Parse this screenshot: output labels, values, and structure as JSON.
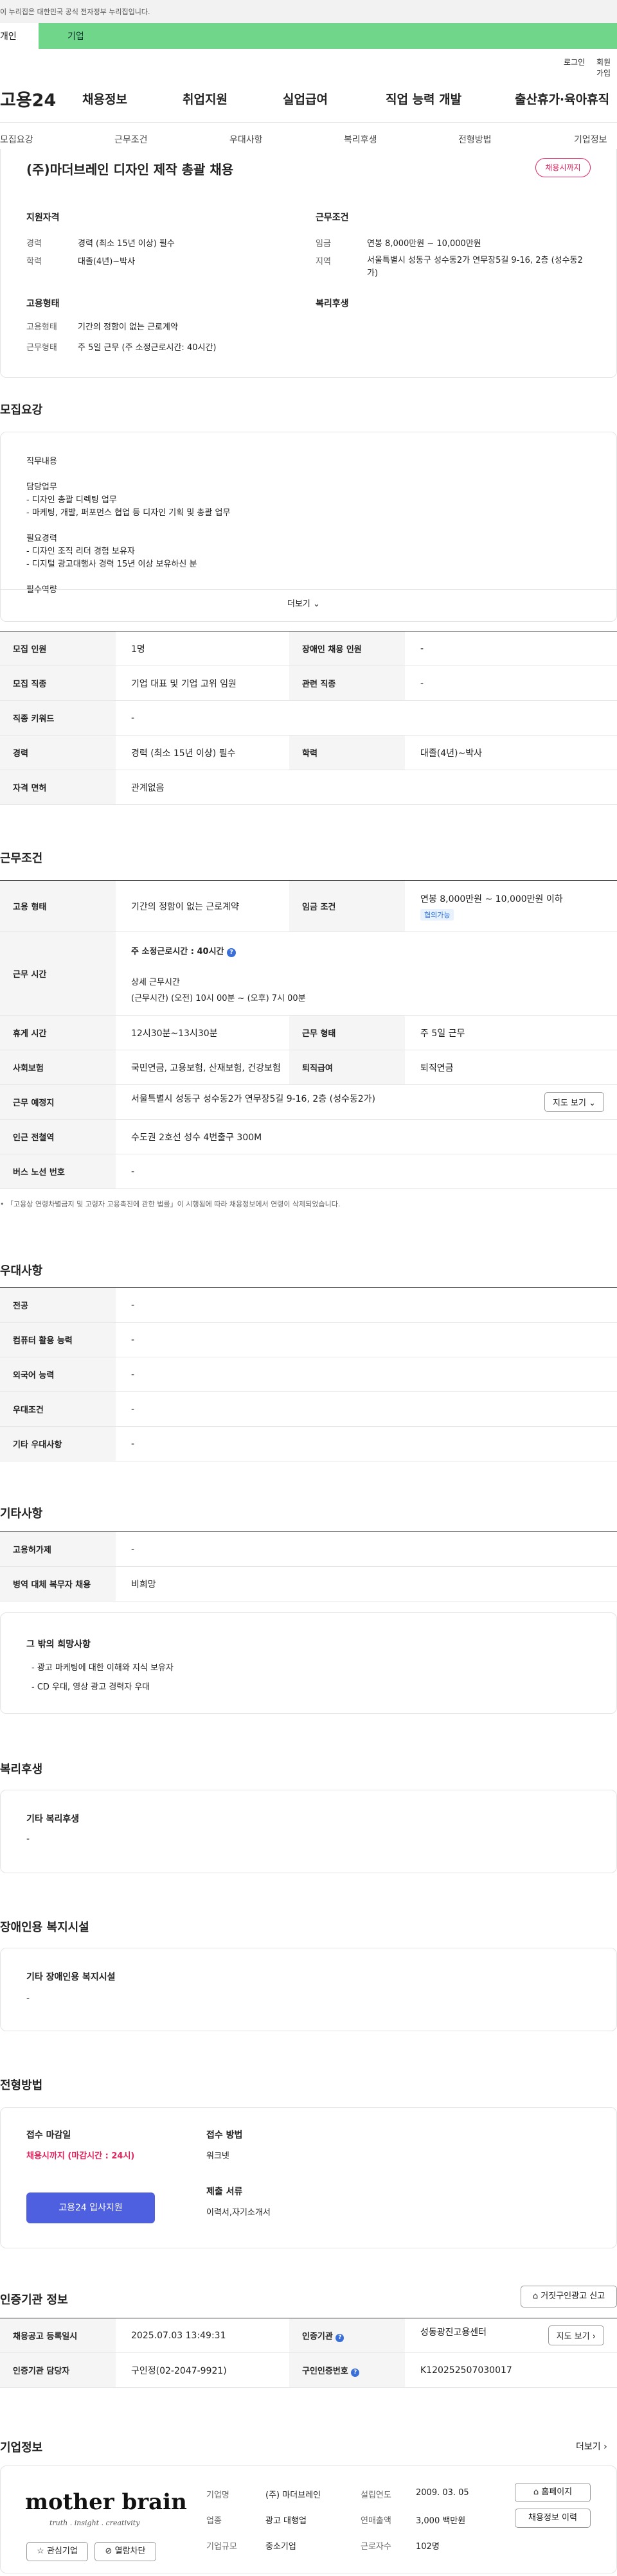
{
  "gov_banner": "이 누리집은 대한민국 공식 전자정부 누리집입니다.",
  "top_tabs": [
    "개인",
    "기업"
  ],
  "util": {
    "login": "로그인",
    "signup": "회원가입"
  },
  "logo": "고용24",
  "nav": [
    "채용정보",
    "취업지원",
    "실업급여",
    "직업 능력 개발",
    "출산휴가·육아휴직"
  ],
  "subnav": [
    "모집요강",
    "근무조건",
    "우대사항",
    "복리후생",
    "전형방법",
    "기업정보"
  ],
  "header": {
    "title": "(주)마더브레인 디자인 제작 총괄 채용",
    "status": "채용시까지",
    "qual_title": "지원자격",
    "career_label": "경력",
    "career_value": "경력 (최소 15년 이상) 필수",
    "edu_label": "학력",
    "edu_value": "대졸(4년)~박사",
    "cond_title": "근무조건",
    "wage_label": "임금",
    "wage_value": "연봉 8,000만원 ~ 10,000만원",
    "region_label": "지역",
    "region_value": "서울특별시 성동구 성수동2가 연무장5길 9-16, 2층 (성수동2가)",
    "emp_title": "고용형태",
    "emp_label": "고용형태",
    "emp_value": "기간의 정함이 없는 근로계약",
    "worktype_label": "근무형태",
    "worktype_value": "주 5일 근무 (주 소정근로시간: 40시간)",
    "welfare_title": "복리후생"
  },
  "recruit": {
    "title": "모집요강",
    "lines": [
      "직무내용",
      "",
      "담당업무",
      "- 디자인 총괄 디렉팅 업무",
      "- 마케팅, 개발, 퍼포먼스 협업 등 디자인 기획 및 총괄 업무",
      "",
      "필요경력",
      "- 디자인 조직 리더 경험 보유자",
      "- 디지털 광고대행사 경력 15년 이상 보유하신 분",
      "",
      "필수역량"
    ],
    "more": "더보기",
    "table": [
      [
        "모집 인원",
        "1명",
        "장애인 채용 인원",
        "-"
      ],
      [
        "모집 직종",
        "기업 대표 및 기업 고위 임원",
        "관련 직종",
        "-"
      ],
      [
        "직종 키워드",
        "-"
      ],
      [
        "경력",
        "경력 (최소 15년 이상) 필수",
        "학력",
        "대졸(4년)~박사"
      ],
      [
        "자격 면허",
        "관계없음"
      ]
    ]
  },
  "work": {
    "title": "근무조건",
    "emp_label": "고용 형태",
    "emp_value": "기간의 정함이 없는 근로계약",
    "wage_label": "임금 조건",
    "wage_value": "연봉 8,000만원 ~ 10,000만원 이하",
    "wage_badge": "협의가능",
    "time_label": "근무 시간",
    "weekly": "주 소정근로시간 : 40시간",
    "detail_title": "상세 근무시간",
    "detail_value": "(근무시간) (오전) 10시 00분 ~ (오후) 7시 00분",
    "rows": [
      [
        "휴게 시간",
        "12시30분~13시30분",
        "근무 형태",
        "주 5일 근무"
      ],
      [
        "사회보험",
        "국민연금, 고용보험, 산재보험, 건강보험",
        "퇴직급여",
        "퇴직연금"
      ]
    ],
    "place_label": "근무 예정지",
    "place_value": "서울특별시 성동구 성수동2가 연무장5길 9-16, 2층 (성수동2가)",
    "map_btn": "지도 보기",
    "station_label": "인근 전철역",
    "station_value": "수도권 2호선 성수 4번출구 300M",
    "bus_label": "버스 노선 번호",
    "bus_value": "-",
    "note": "「고용상 연령차별금지 및 고령자 고용촉진에 관한 법률」이 시행됨에 따라 채용정보에서 연령이 삭제되었습니다."
  },
  "pref": {
    "title": "우대사항",
    "rows": [
      [
        "전공",
        "-"
      ],
      [
        "컴퓨터 활용 능력",
        "-"
      ],
      [
        "외국어 능력",
        "-"
      ],
      [
        "우대조건",
        "-"
      ],
      [
        "기타 우대사항",
        "-"
      ]
    ]
  },
  "etc": {
    "title": "기타사항",
    "rows": [
      [
        "고용허가제",
        "-"
      ],
      [
        "병역 대체 복무자 채용",
        "비희망"
      ]
    ],
    "wish_title": "그 밖의 희망사항",
    "wish": [
      "- 광고 마케팅에 대한 이해와 지식 보유자",
      "- CD 우대, 영상 광고 경력자 우대"
    ]
  },
  "welfare": {
    "title": "복리후생",
    "sub": "기타 복리후생",
    "value": "-"
  },
  "disabled": {
    "title": "장애인용 복지시설",
    "sub": "기타 장애인용 복지시설",
    "value": "-"
  },
  "selection": {
    "title": "전형방법",
    "deadline_label": "접수 마감일",
    "deadline_value": "채용시까지 (마감시간 : 24시)",
    "apply_btn": "고용24 입사지원",
    "method_label": "접수 방법",
    "method_value": "워크넷",
    "docs_label": "제출 서류",
    "docs_value": "이력서,자기소개서"
  },
  "cert": {
    "title": "인증기관 정보",
    "report_btn": "거짓구인광고 신고",
    "reg_label": "채용공고 등록일시",
    "reg_value": "2025.07.03 13:49:31",
    "org_label": "인증기관",
    "org_value": "성동광진고용센터",
    "map_btn": "지도 보기",
    "manager_label": "인증기관 담당자",
    "manager_value": "구인정(02-2047-9921)",
    "cert_label": "구인인증번호",
    "cert_value": "K120252507030017"
  },
  "company": {
    "title": "기업정보",
    "more": "더보기",
    "logo_text": "mother brain",
    "logo_tag": "truth . insight . creativity",
    "fav_btn": "관심기업",
    "block_btn": "열람차단",
    "name_label": "기업명",
    "name_value": "(주) 마더브레인",
    "founded_label": "설립연도",
    "founded_value": "2009. 03. 05",
    "industry_label": "업종",
    "industry_value": "광고 대행업",
    "sales_label": "연매출액",
    "sales_value": "3,000 백만원",
    "size_label": "기업규모",
    "size_value": "중소기업",
    "employees_label": "근로자수",
    "employees_value": "102명",
    "home_btn": "홈페이지",
    "jobs_btn": "채용정보 이력"
  },
  "colors": {
    "accent_green": "#6fd68a",
    "apply_blue": "#4e5fe0",
    "status_red": "#e0245e",
    "brand_dark": "#111111"
  }
}
